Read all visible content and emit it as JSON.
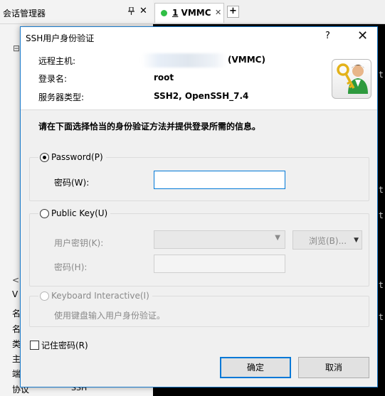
{
  "background": {
    "session_manager_title": "会话管理器",
    "pin_icon": "pin-icon",
    "close_glyph": "✕",
    "tree_collapse_glyph": "⊟",
    "scroll_left_glyph": "<",
    "vm_label_fragment": "V",
    "property_fragments": [
      "名",
      "名",
      "类",
      "主",
      "端",
      "协议"
    ],
    "protocol_value_fragment": "SSH",
    "tab": {
      "number": "1",
      "label": "VMMC",
      "status_color": "#2fbf45",
      "close_glyph": "✕"
    },
    "new_tab_glyph": "+",
    "terminal_fragments": [
      "t",
      "t",
      "t",
      "t",
      "t"
    ]
  },
  "dialog": {
    "title": "SSH用户身份验证",
    "help_glyph": "?",
    "close_glyph": "✕",
    "info": {
      "remote_host_label": "远程主机:",
      "remote_host_value": "(VMMC)",
      "login_name_label": "登录名:",
      "login_name_value": "root",
      "server_type_label": "服务器类型:",
      "server_type_value": "SSH2, OpenSSH_7.4"
    },
    "instruction": "请在下面选择恰当的身份验证方法并提供登录所需的信息。",
    "password_group": {
      "option_label": "Password(P)",
      "checked": true,
      "password_label": "密码(W):",
      "password_value": ""
    },
    "public_key_group": {
      "option_label": "Public Key(U)",
      "checked": false,
      "user_key_label": "用户密钥(K):",
      "user_key_value": "",
      "browse_label": "浏览(B)...",
      "passphrase_label": "密码(H):",
      "passphrase_value": ""
    },
    "keyboard_group": {
      "option_label": "Keyboard Interactive(I)",
      "checked": false,
      "description": "使用键盘输入用户身份验证。"
    },
    "remember_password_label": "记住密码(R)",
    "remember_password_checked": false,
    "ok_label": "确定",
    "cancel_label": "取消",
    "accent_color": "#0078d7"
  }
}
